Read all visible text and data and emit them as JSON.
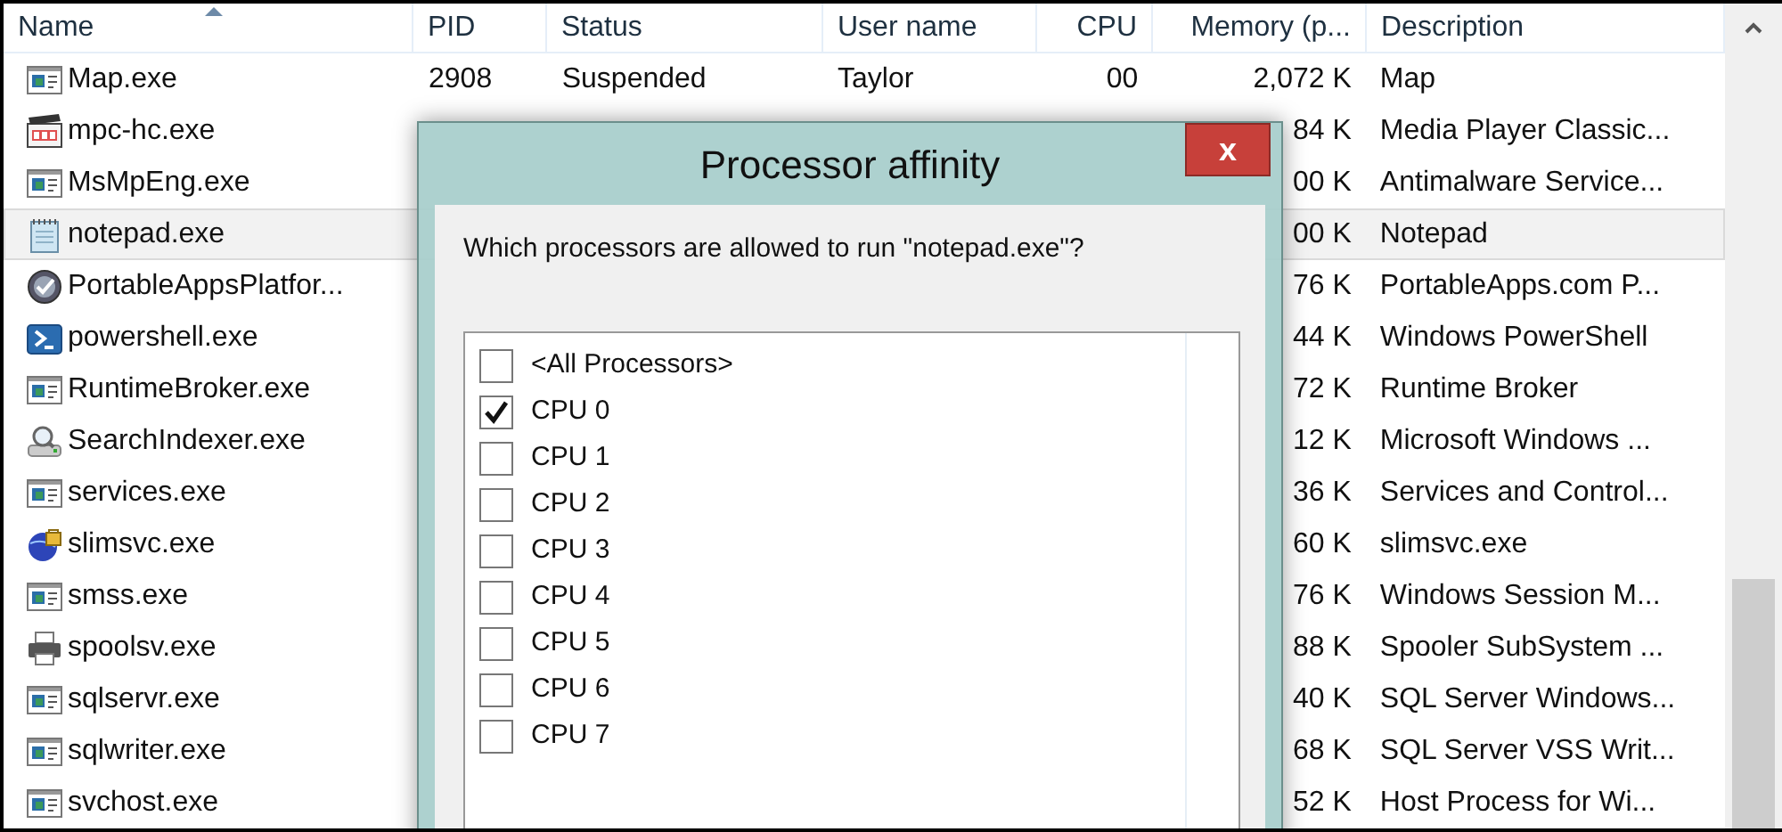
{
  "table": {
    "columns": [
      {
        "label": "Name",
        "sorted": true
      },
      {
        "label": "PID",
        "sorted": false
      },
      {
        "label": "Status",
        "sorted": false
      },
      {
        "label": "User name",
        "sorted": false
      },
      {
        "label": "CPU",
        "sorted": false
      },
      {
        "label": "Memory (p...",
        "sorted": false
      },
      {
        "label": "Description",
        "sorted": false
      }
    ],
    "rows": [
      {
        "kind": "app",
        "name": "Map.exe",
        "pid": "2908",
        "status": "Suspended",
        "user": "Taylor",
        "cpu": "00",
        "memory": "2,072 K",
        "description": "Map",
        "selected": false
      },
      {
        "kind": "media",
        "name": "mpc-hc.exe",
        "memory": "84 K",
        "description": "Media Player Classic...",
        "selected": false
      },
      {
        "kind": "app",
        "name": "MsMpEng.exe",
        "memory": "00 K",
        "description": "Antimalware Service...",
        "selected": false
      },
      {
        "kind": "notepad",
        "name": "notepad.exe",
        "memory": "00 K",
        "description": "Notepad",
        "selected": true
      },
      {
        "kind": "globe",
        "name": "PortableAppsPlatfor...",
        "memory": "76 K",
        "description": "PortableApps.com P...",
        "selected": false
      },
      {
        "kind": "shell",
        "name": "powershell.exe",
        "memory": "44 K",
        "description": "Windows PowerShell",
        "selected": false
      },
      {
        "kind": "app",
        "name": "RuntimeBroker.exe",
        "memory": "72 K",
        "description": "Runtime Broker",
        "selected": false
      },
      {
        "kind": "search",
        "name": "SearchIndexer.exe",
        "memory": "12 K",
        "description": "Microsoft Windows ...",
        "selected": false
      },
      {
        "kind": "app",
        "name": "services.exe",
        "memory": "36 K",
        "description": "Services and Control...",
        "selected": false
      },
      {
        "kind": "lockglobe",
        "name": "slimsvc.exe",
        "memory": "60 K",
        "description": "slimsvc.exe",
        "selected": false
      },
      {
        "kind": "app",
        "name": "smss.exe",
        "memory": "76 K",
        "description": "Windows Session M...",
        "selected": false
      },
      {
        "kind": "printer",
        "name": "spoolsv.exe",
        "memory": "88 K",
        "description": "Spooler SubSystem ...",
        "selected": false
      },
      {
        "kind": "app",
        "name": "sqlservr.exe",
        "memory": "40 K",
        "description": "SQL Server Windows...",
        "selected": false
      },
      {
        "kind": "app",
        "name": "sqlwriter.exe",
        "memory": "68 K",
        "description": "SQL Server VSS Writ...",
        "selected": false
      },
      {
        "kind": "app",
        "name": "svchost.exe",
        "memory": "52 K",
        "description": "Host Process for Wi...",
        "selected": false
      }
    ]
  },
  "dialog": {
    "title": "Processor affinity",
    "close": "x",
    "question": "Which processors are allowed to run \"notepad.exe\"?",
    "options": [
      {
        "label": "<All Processors>",
        "checked": false
      },
      {
        "label": "CPU 0",
        "checked": true
      },
      {
        "label": "CPU 1",
        "checked": false
      },
      {
        "label": "CPU 2",
        "checked": false
      },
      {
        "label": "CPU 3",
        "checked": false
      },
      {
        "label": "CPU 4",
        "checked": false
      },
      {
        "label": "CPU 5",
        "checked": false
      },
      {
        "label": "CPU 6",
        "checked": false
      },
      {
        "label": "CPU 7",
        "checked": false
      }
    ]
  }
}
